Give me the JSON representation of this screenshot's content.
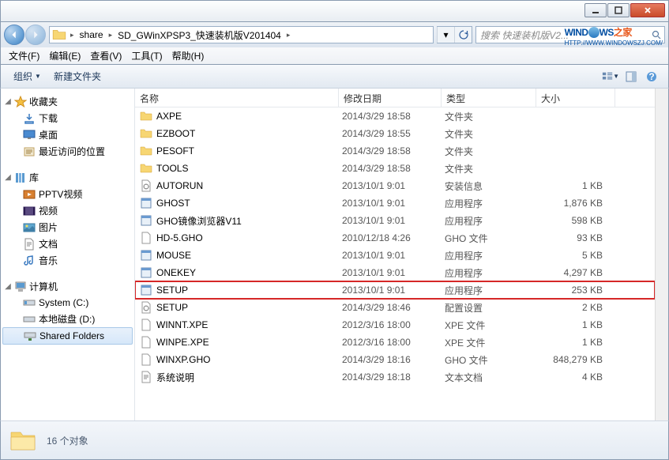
{
  "breadcrumb": [
    "share",
    "SD_GWinXPSP3_快速装机版V201404"
  ],
  "search_placeholder": "搜索 快速装机版V2...",
  "watermark": {
    "t1": "WIND",
    "t2": "WS",
    "t3": "之家",
    "url": "HTTP://WWW.WINDOWSZJ.COM/"
  },
  "menu": [
    "文件(F)",
    "编辑(E)",
    "查看(V)",
    "工具(T)",
    "帮助(H)"
  ],
  "toolbar": {
    "org": "组织",
    "newf": "新建文件夹"
  },
  "columns": {
    "name": "名称",
    "date": "修改日期",
    "type": "类型",
    "size": "大小"
  },
  "sidebar": {
    "fav": {
      "label": "收藏夹",
      "items": [
        "下载",
        "桌面",
        "最近访问的位置"
      ]
    },
    "lib": {
      "label": "库",
      "items": [
        "PPTV视频",
        "视频",
        "图片",
        "文档",
        "音乐"
      ]
    },
    "comp": {
      "label": "计算机",
      "items": [
        "System (C:)",
        "本地磁盘 (D:)",
        "Shared Folders"
      ]
    }
  },
  "files": [
    {
      "name": "AXPE",
      "date": "2014/3/29 18:58",
      "type": "文件夹",
      "size": "",
      "kind": "folder"
    },
    {
      "name": "EZBOOT",
      "date": "2014/3/29 18:55",
      "type": "文件夹",
      "size": "",
      "kind": "folder"
    },
    {
      "name": "PESOFT",
      "date": "2014/3/29 18:58",
      "type": "文件夹",
      "size": "",
      "kind": "folder"
    },
    {
      "name": "TOOLS",
      "date": "2014/3/29 18:58",
      "type": "文件夹",
      "size": "",
      "kind": "folder"
    },
    {
      "name": "AUTORUN",
      "date": "2013/10/1 9:01",
      "type": "安装信息",
      "size": "1 KB",
      "kind": "inf"
    },
    {
      "name": "GHOST",
      "date": "2013/10/1 9:01",
      "type": "应用程序",
      "size": "1,876 KB",
      "kind": "exe"
    },
    {
      "name": "GHO镜像浏览器V11",
      "date": "2013/10/1 9:01",
      "type": "应用程序",
      "size": "598 KB",
      "kind": "exe"
    },
    {
      "name": "HD-5.GHO",
      "date": "2010/12/18 4:26",
      "type": "GHO 文件",
      "size": "93 KB",
      "kind": "file"
    },
    {
      "name": "MOUSE",
      "date": "2013/10/1 9:01",
      "type": "应用程序",
      "size": "5 KB",
      "kind": "exe"
    },
    {
      "name": "ONEKEY",
      "date": "2013/10/1 9:01",
      "type": "应用程序",
      "size": "4,297 KB",
      "kind": "exe"
    },
    {
      "name": "SETUP",
      "date": "2013/10/1 9:01",
      "type": "应用程序",
      "size": "253 KB",
      "kind": "exe",
      "hl": true
    },
    {
      "name": "SETUP",
      "date": "2014/3/29 18:46",
      "type": "配置设置",
      "size": "2 KB",
      "kind": "ini"
    },
    {
      "name": "WINNT.XPE",
      "date": "2012/3/16 18:00",
      "type": "XPE 文件",
      "size": "1 KB",
      "kind": "file"
    },
    {
      "name": "WINPE.XPE",
      "date": "2012/3/16 18:00",
      "type": "XPE 文件",
      "size": "1 KB",
      "kind": "file"
    },
    {
      "name": "WINXP.GHO",
      "date": "2014/3/29 18:16",
      "type": "GHO 文件",
      "size": "848,279 KB",
      "kind": "file"
    },
    {
      "name": "系统说明",
      "date": "2014/3/29 18:18",
      "type": "文本文档",
      "size": "4 KB",
      "kind": "txt"
    }
  ],
  "status": "16 个对象"
}
